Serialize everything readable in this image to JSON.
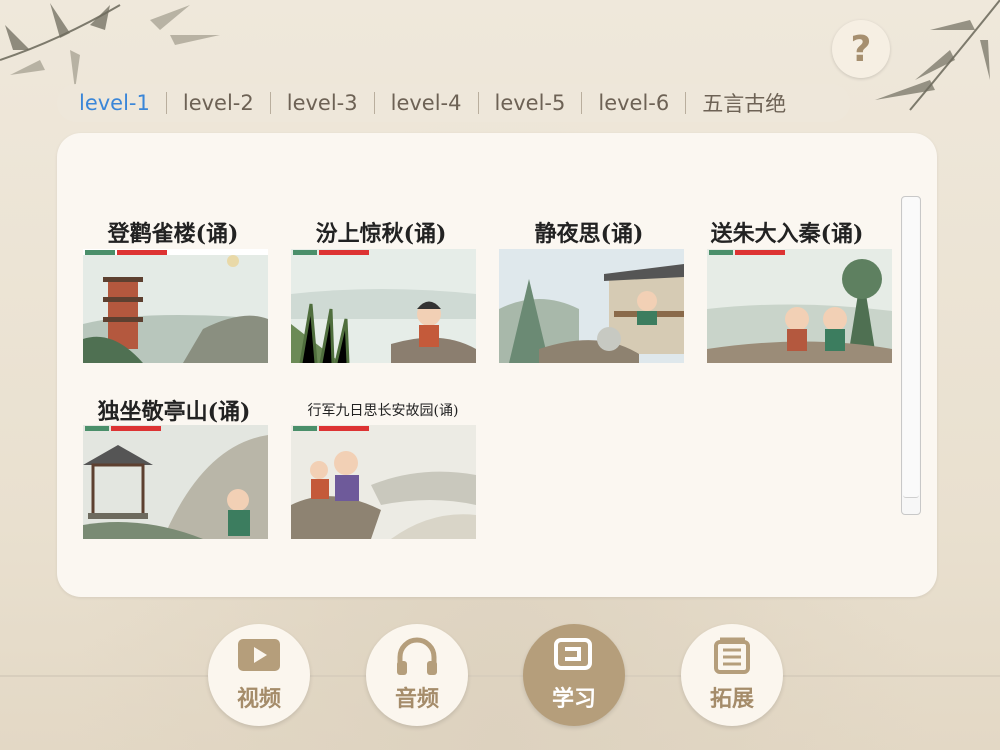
{
  "help": {
    "label": "?"
  },
  "tabs": [
    {
      "label": "level-1",
      "active": true
    },
    {
      "label": "level-2",
      "active": false
    },
    {
      "label": "level-3",
      "active": false
    },
    {
      "label": "level-4",
      "active": false
    },
    {
      "label": "level-5",
      "active": false
    },
    {
      "label": "level-6",
      "active": false
    },
    {
      "label": "五言古绝",
      "active": false
    }
  ],
  "poems": [
    {
      "title": "登鹳雀楼(诵)",
      "icon": "tower-scene-thumbnail"
    },
    {
      "title": "汾上惊秋(诵)",
      "icon": "river-child-thumbnail"
    },
    {
      "title": "静夜思(诵)",
      "icon": "pavilion-poet-thumbnail"
    },
    {
      "title": "送朱大入秦(诵)",
      "icon": "two-friends-thumbnail"
    },
    {
      "title": "独坐敬亭山(诵)",
      "icon": "mountain-pavilion-thumbnail"
    },
    {
      "title": "行军九日思长安故园(诵)",
      "icon": "soldier-cliff-thumbnail"
    }
  ],
  "nav": [
    {
      "label": "视频",
      "icon": "video-play-icon",
      "active": false
    },
    {
      "label": "音频",
      "icon": "headphones-icon",
      "active": false
    },
    {
      "label": "学习",
      "icon": "study-icon",
      "active": true
    },
    {
      "label": "拓展",
      "icon": "book-list-icon",
      "active": false
    }
  ],
  "colors": {
    "accent": "#3a86d8",
    "nav_active": "#b59e7b",
    "nav_text": "#a58c6a"
  }
}
